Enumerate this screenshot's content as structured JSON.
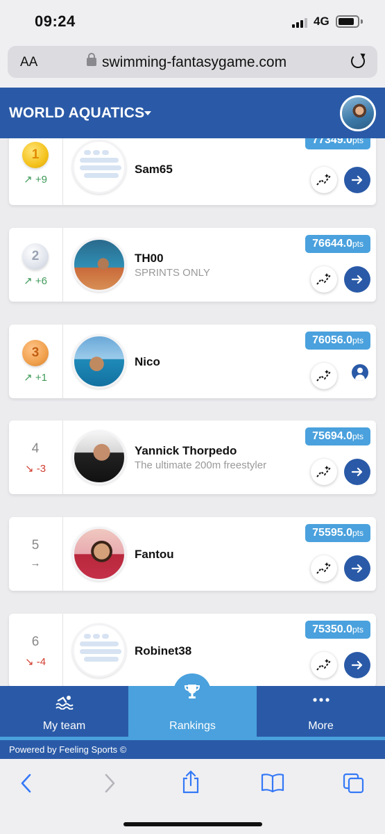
{
  "status_bar": {
    "time": "09:24",
    "network": "4G"
  },
  "browser": {
    "aa_label": "AA",
    "url": "swimming-fantasygame.com"
  },
  "header": {
    "league": "WORLD AQUATICS"
  },
  "rankings": [
    {
      "rank": "1",
      "change": "+9",
      "trend": "up",
      "name": "Sam65",
      "subtitle": "",
      "points": "77349.0",
      "pts_unit": "pts",
      "action": "arrow"
    },
    {
      "rank": "2",
      "change": "+6",
      "trend": "up",
      "name": "TH00",
      "subtitle": "SPRINTS ONLY",
      "points": "76644.0",
      "pts_unit": "pts",
      "action": "arrow"
    },
    {
      "rank": "3",
      "change": "+1",
      "trend": "up",
      "name": "Nico",
      "subtitle": "",
      "points": "76056.0",
      "pts_unit": "pts",
      "action": "profile"
    },
    {
      "rank": "4",
      "change": "-3",
      "trend": "down",
      "name": "Yannick Thorpedo",
      "subtitle": "The ultimate 200m freestyler",
      "points": "75694.0",
      "pts_unit": "pts",
      "action": "arrow"
    },
    {
      "rank": "5",
      "change": "→",
      "trend": "same",
      "name": "Fantou",
      "subtitle": "",
      "points": "75595.0",
      "pts_unit": "pts",
      "action": "arrow"
    },
    {
      "rank": "6",
      "change": "-4",
      "trend": "down",
      "name": "Robinet38",
      "subtitle": "",
      "points": "75350.0",
      "pts_unit": "pts",
      "action": "arrow"
    }
  ],
  "nav": {
    "my_team": "My team",
    "rankings": "Rankings",
    "more": "More"
  },
  "footer": {
    "powered_by": "Powered by  Feeling Sports ©"
  },
  "colors": {
    "primary": "#2a5aa7",
    "accent": "#4aa1dd",
    "up": "#3f9a5a",
    "down": "#d23c2f"
  }
}
